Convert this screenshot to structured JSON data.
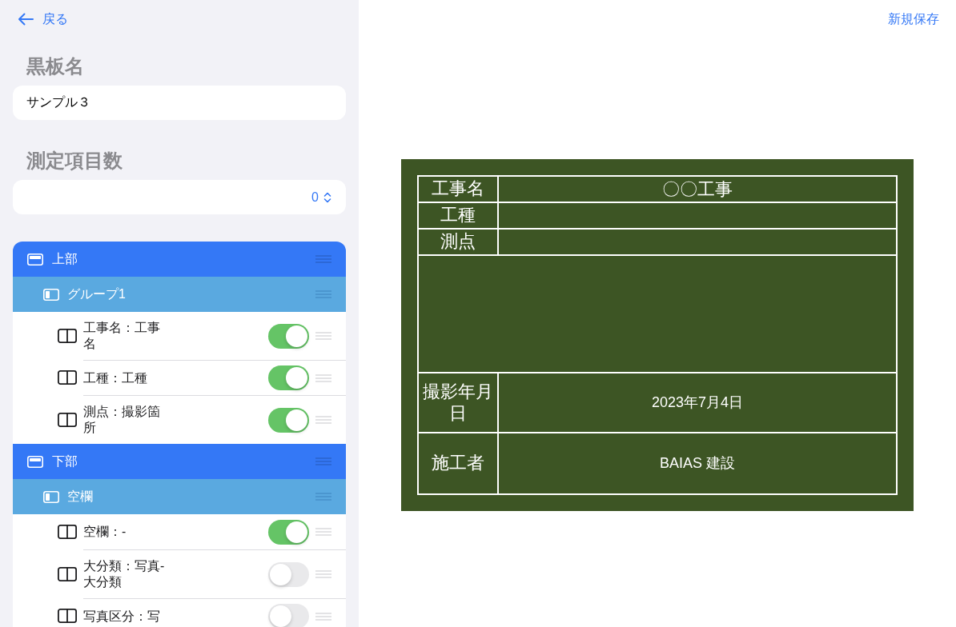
{
  "nav": {
    "back": "戻る",
    "save": "新規保存"
  },
  "fields": [
    {
      "kind": "text",
      "label": "黒板名",
      "value": "サンプル３"
    },
    {
      "kind": "stepper",
      "label": "測定項目数",
      "value": "0"
    }
  ],
  "layout_tree": [
    {
      "kind": "section",
      "label": "上部",
      "children": [
        {
          "kind": "group",
          "label": "グループ1",
          "children": [
            {
              "kind": "item",
              "label": "工事名：工事名",
              "on": true
            },
            {
              "kind": "item",
              "label": "工種：工種",
              "on": true
            },
            {
              "kind": "item",
              "label": "測点：撮影箇所",
              "on": true
            }
          ]
        }
      ]
    },
    {
      "kind": "section",
      "label": "下部",
      "children": [
        {
          "kind": "group",
          "label": "空欄",
          "children": [
            {
              "kind": "item",
              "label": "空欄：-",
              "on": true
            },
            {
              "kind": "item",
              "label": "大分類：写真-大分類",
              "on": false
            },
            {
              "kind": "item",
              "label": "写真区分：写",
              "on": false
            }
          ]
        }
      ]
    }
  ],
  "blackboard": {
    "upper_rows": [
      {
        "label": "工事名",
        "value": "〇〇工事"
      },
      {
        "label": "工種"
      },
      {
        "label": "測点"
      }
    ],
    "lower_rows": [
      {
        "label": "撮影年月日",
        "value": "2023年7月4日"
      },
      {
        "label": "施工者",
        "value": "BAIAS 建設"
      }
    ]
  }
}
